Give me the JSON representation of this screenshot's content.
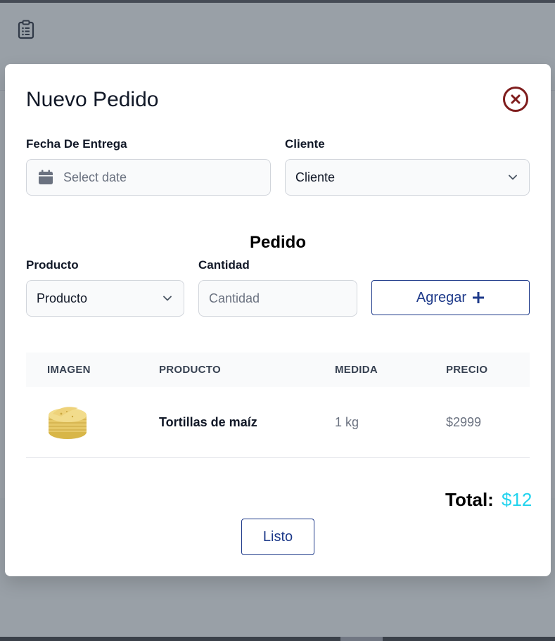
{
  "modal": {
    "title": "Nuevo Pedido"
  },
  "form": {
    "delivery_date": {
      "label": "Fecha De Entrega",
      "placeholder": "Select date"
    },
    "client": {
      "label": "Cliente",
      "selected": "Cliente"
    }
  },
  "order": {
    "section_title": "Pedido",
    "product": {
      "label": "Producto",
      "selected": "Producto"
    },
    "quantity": {
      "label": "Cantidad",
      "placeholder": "Cantidad"
    },
    "add_button": "Agregar"
  },
  "table": {
    "headers": [
      "IMAGEN",
      "PRODUCTO",
      "MEDIDA",
      "PRECIO"
    ],
    "rows": [
      {
        "image_icon": "tortillas-image",
        "product": "Tortillas de maíz",
        "measure": "1 kg",
        "price": "$2999"
      }
    ]
  },
  "summary": {
    "total_label": "Total:",
    "total_value": "$12"
  },
  "done_button": "Listo",
  "colors": {
    "primary": "#1e3a8a",
    "close": "#7f1d1d",
    "total": "#22d3ee"
  },
  "icons": {
    "app": "clipboard-list-icon",
    "close": "close-circle-icon",
    "calendar": "calendar-icon",
    "chevron": "chevron-down-icon",
    "plus": "plus-icon"
  }
}
